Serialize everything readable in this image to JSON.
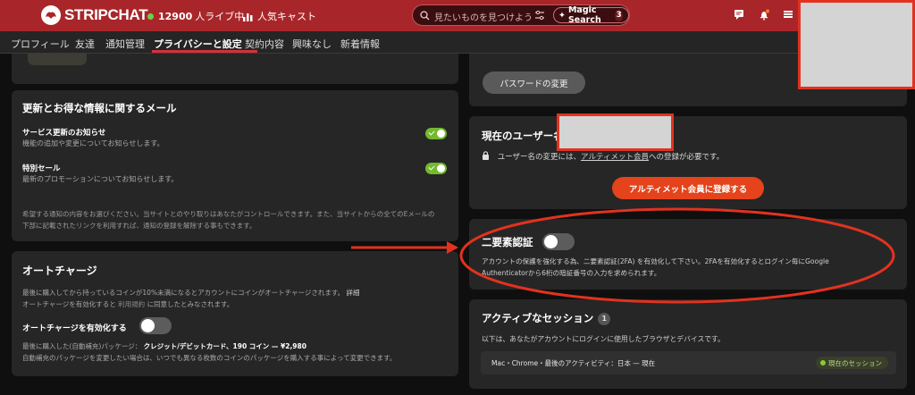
{
  "header": {
    "logo_text": "STRIPCHAT",
    "live_count": "12900",
    "live_label": "人ライブ中",
    "popular_label": "人気キャスト",
    "search_placeholder": "見たいものを見つけよう",
    "magic_search_label": "Magic Search",
    "magic_search_count": "3"
  },
  "tabs": [
    {
      "label": "プロフィール"
    },
    {
      "label": "友達"
    },
    {
      "label": "通知管理"
    },
    {
      "label": "プライバシーと設定"
    },
    {
      "label": "契約内容"
    },
    {
      "label": "興味なし"
    },
    {
      "label": "新着情報"
    }
  ],
  "email_panel": {
    "title": "更新とお得な情報に関するメール",
    "items": [
      {
        "title": "サービス更新のお知らせ",
        "desc": "機能の追加や変更についてお知らせします。"
      },
      {
        "title": "特別セール",
        "desc": "最新のプロモーションについてお知らせします。"
      }
    ],
    "note_line1": "希望する通知の内容をお選びください。当サイトとのやり取りはあなたがコントロールできます。また、当サイトからの全てのEメールの",
    "note_line2": "下部に記載されたリンクを利用すれば、通知の登録を解除する事もできます。"
  },
  "autocharge_panel": {
    "title": "オートチャージ",
    "desc_line1": "最後に購入してから持っているコインが10%未満になるとアカウントにコインがオートチャージされます。",
    "desc_link1": "詳細",
    "desc_line2_a": "オートチャージを有効化すると",
    "desc_link2": "利用規約",
    "desc_line2_b": "に同意したとみなされます。",
    "toggle_label": "オートチャージを有効化する",
    "package_prefix": "最後に購入した(自動補充)パッケージ：",
    "package_value": "クレジット/デビットカード、190 コイン — ¥2,980",
    "footer": "自動補充のパッケージを変更したい場合は、いつでも異なる枚数のコインのパッケージを購入する事によって変更できます。"
  },
  "password": {
    "button_label": "パスワードの変更"
  },
  "username_panel": {
    "title": "現在のユーザー名",
    "note_prefix": "ユーザー名の変更には、",
    "note_link": "アルティメット会員",
    "note_suffix": "への登録が必要です。",
    "button_label": "アルティメット会員に登録する"
  },
  "twofa_panel": {
    "title": "二要素認証",
    "desc_line1": "アカウントの保護を強化する為、二要素認証(2FA) を有効化して下さい。2FAを有効化するとログイン毎にGoogle",
    "desc_line2": "Authenticatorから6桁の暗証番号の入力を求められます。"
  },
  "sessions_panel": {
    "title": "アクティブなセッション",
    "count": "1",
    "desc": "以下は、あなたがアカウントにログインに使用したブラウザとデバイスです。",
    "session_text": "Mac・Chrome・最後のアクティビティ：日本 — 現在",
    "session_badge": "現在のセッション"
  },
  "colors": {
    "header_bg": "#a8262a",
    "accent_orange": "#e4431b",
    "annotation_red": "#e2321f",
    "toggle_on": "#74b830"
  }
}
